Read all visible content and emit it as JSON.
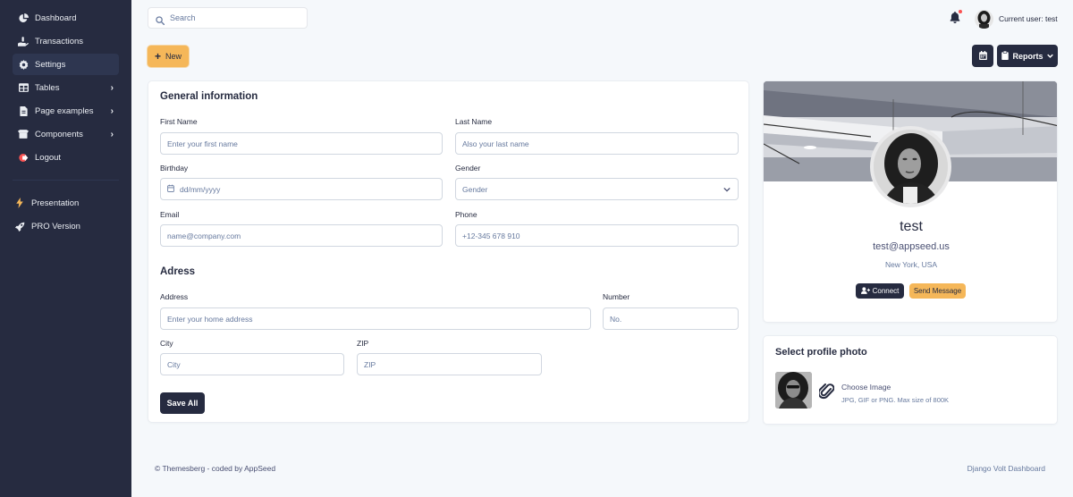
{
  "sidebar": {
    "items": [
      {
        "label": "Dashboard",
        "icon": "chart-pie-icon",
        "active": false,
        "has_children": false
      },
      {
        "label": "Transactions",
        "icon": "hand-holding-usd-icon",
        "active": false,
        "has_children": false
      },
      {
        "label": "Settings",
        "icon": "cog-icon",
        "active": true,
        "has_children": false
      },
      {
        "label": "Tables",
        "icon": "table-icon",
        "active": false,
        "has_children": true
      },
      {
        "label": "Page examples",
        "icon": "file-alt-icon",
        "active": false,
        "has_children": true
      },
      {
        "label": "Components",
        "icon": "box-open-icon",
        "active": false,
        "has_children": true
      },
      {
        "label": "Logout",
        "icon": "sign-out-icon",
        "active": false,
        "has_children": false
      }
    ],
    "extra_items": [
      {
        "label": "Presentation",
        "icon": "bolt-icon"
      },
      {
        "label": "PRO Version",
        "icon": "rocket-icon"
      }
    ]
  },
  "topbar": {
    "search_placeholder": "Search",
    "current_user_label": "Current user: test",
    "notification_icon": "bell-icon",
    "has_notification": true
  },
  "actions": {
    "new_label": "New",
    "calendar_icon": "calendar-icon",
    "reports_label": "Reports"
  },
  "general": {
    "title": "General information",
    "first_name": {
      "label": "First Name",
      "placeholder": "Enter your first name",
      "value": ""
    },
    "last_name": {
      "label": "Last Name",
      "placeholder": "Also your last name",
      "value": ""
    },
    "birthday": {
      "label": "Birthday",
      "placeholder": "dd/mm/yyyy",
      "value": ""
    },
    "gender": {
      "label": "Gender",
      "selected": "Gender"
    },
    "email": {
      "label": "Email",
      "placeholder": "name@company.com",
      "value": ""
    },
    "phone": {
      "label": "Phone",
      "placeholder": "+12-345 678 910",
      "value": ""
    }
  },
  "address": {
    "title": "Adress",
    "address": {
      "label": "Address",
      "placeholder": "Enter your home address",
      "value": ""
    },
    "number": {
      "label": "Number",
      "placeholder": "No.",
      "value": ""
    },
    "city": {
      "label": "City",
      "placeholder": "City",
      "value": ""
    },
    "zip": {
      "label": "ZIP",
      "placeholder": "ZIP",
      "value": ""
    },
    "save_label": "Save All"
  },
  "profile": {
    "name": "test",
    "email": "test@appseed.us",
    "location": "New York, USA",
    "connect_label": "Connect",
    "message_label": "Send Message"
  },
  "photo": {
    "title": "Select profile photo",
    "choose_label": "Choose Image",
    "hint": "JPG, GIF or PNG. Max size of 800K"
  },
  "footer": {
    "left": "© Themesberg - coded by AppSeed",
    "right": "Django Volt Dashboard"
  },
  "colors": {
    "sidebar_bg": "#262b40",
    "accent_secondary": "#f5b759",
    "primary": "#262b40",
    "page_bg": "#f5f8fb",
    "danger": "#fa5252"
  }
}
